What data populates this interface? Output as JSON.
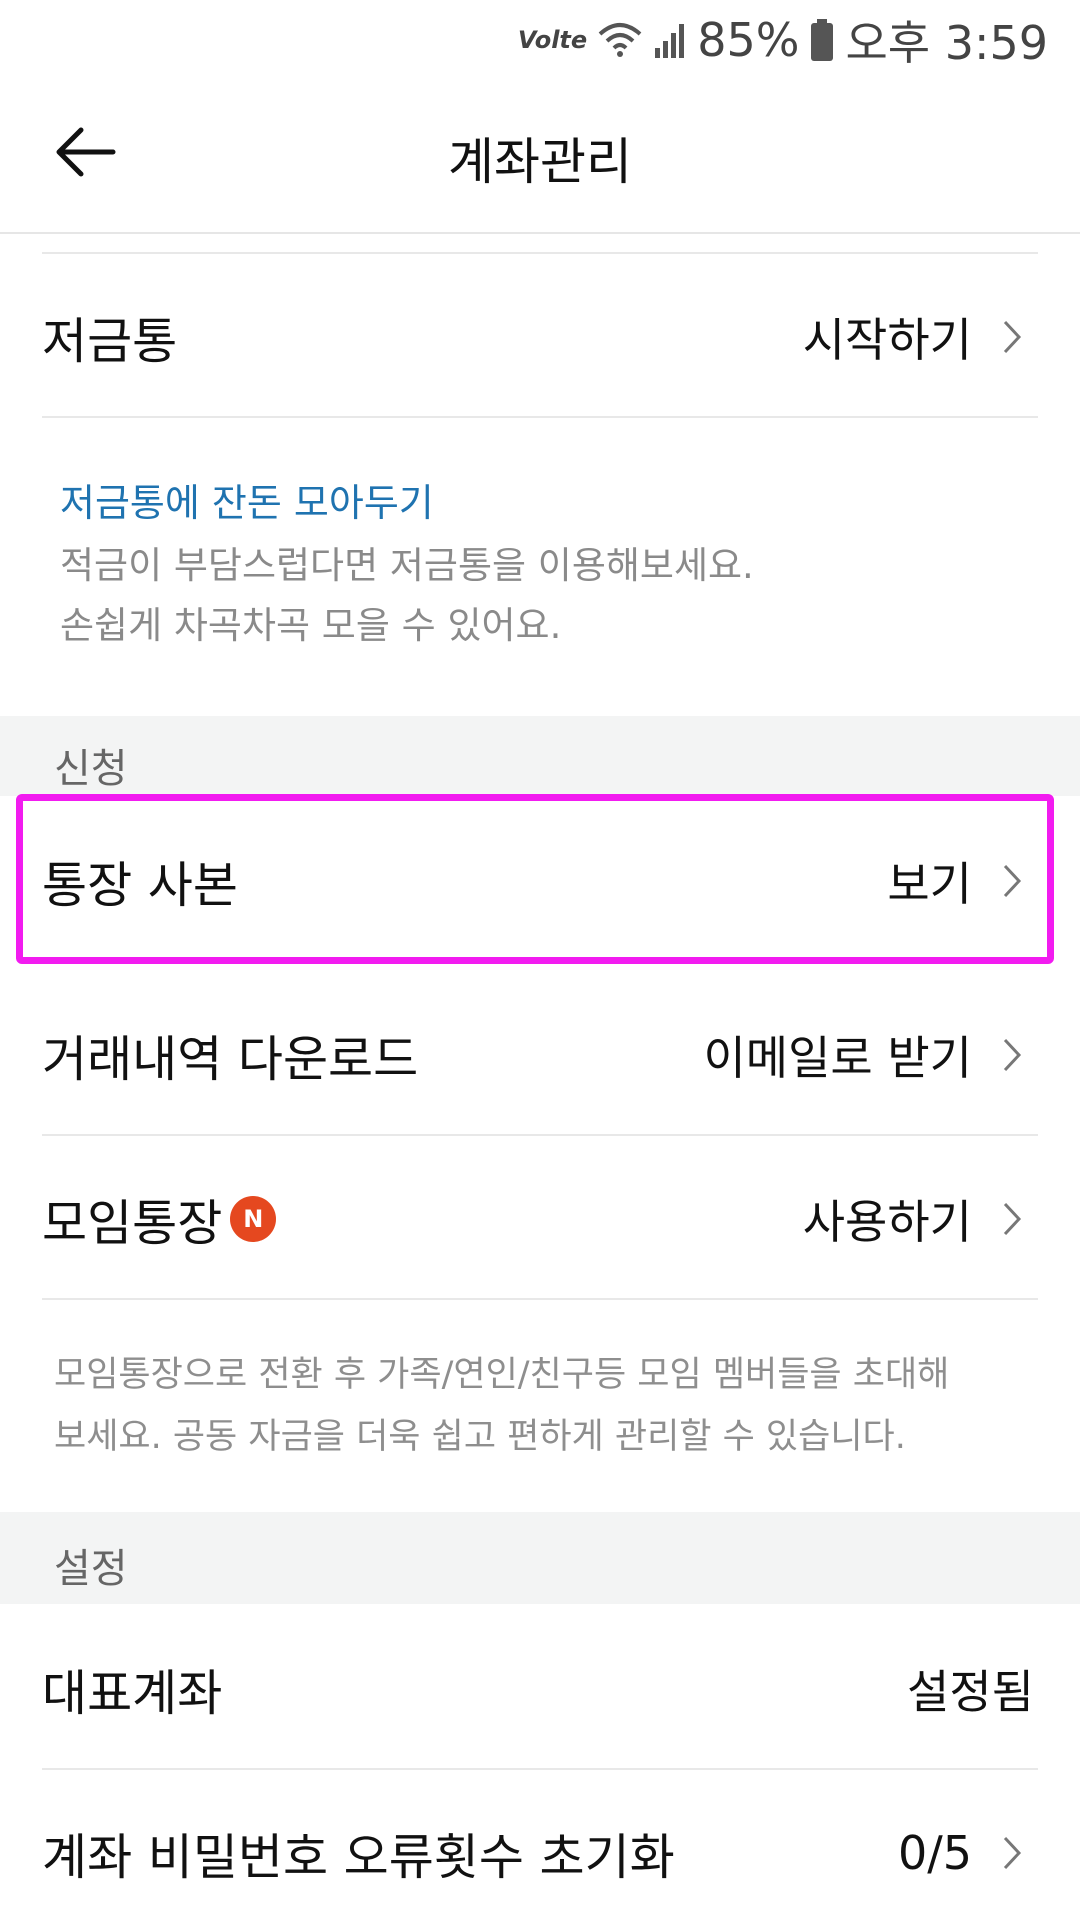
{
  "status_bar": {
    "network_label": "Volte",
    "battery": "85%",
    "time": "오후 3:59"
  },
  "header": {
    "title": "계좌관리",
    "back_icon": "arrow-left-icon"
  },
  "piggy_bank": {
    "label": "저금통",
    "action": "시작하기",
    "promo_title": "저금통에 잔돈 모아두기",
    "promo_line1": "적금이 부담스럽다면 저금통을 이용해보세요.",
    "promo_line2": "손쉽게 차곡차곡 모을 수 있어요."
  },
  "sections": {
    "apply": "신청",
    "settings": "설정"
  },
  "apply_items": [
    {
      "label": "통장 사본",
      "action": "보기"
    },
    {
      "label": "거래내역 다운로드",
      "action": "이메일로 받기"
    },
    {
      "label": "모임통장",
      "badge": "N",
      "action": "사용하기"
    }
  ],
  "group_account_desc": {
    "line1": "모임통장으로 전환 후 가족/연인/친구등 모임 멤버들을 초대해",
    "line2": "보세요. 공동 자금을 더욱 쉽고 편하게 관리할 수 있습니다."
  },
  "settings_items": [
    {
      "label": "대표계좌",
      "value": "설정됨"
    },
    {
      "label": "계좌 비밀번호 오류횟수 초기화",
      "value": "0/5"
    }
  ],
  "colors": {
    "accent_blue": "#1f73b0",
    "badge_red": "#e5481f",
    "highlight_magenta": "#f21bf0"
  }
}
